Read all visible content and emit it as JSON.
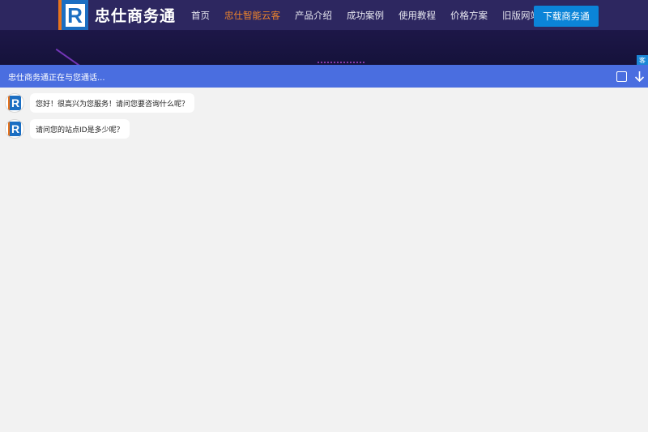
{
  "header": {
    "logo_text": "忠仕商务通",
    "logo_letter": "R",
    "nav": [
      {
        "label": "首页",
        "active": false
      },
      {
        "label": "忠仕智能云客",
        "active": true
      },
      {
        "label": "产品介绍",
        "active": false
      },
      {
        "label": "成功案例",
        "active": false
      },
      {
        "label": "使用教程",
        "active": false
      },
      {
        "label": "价格方案",
        "active": false
      },
      {
        "label": "旧版网站",
        "active": false
      }
    ],
    "download_label": "下载商务通",
    "side_tab_label": "客"
  },
  "chat": {
    "status_text": "忠仕商务通正在与您通话...",
    "avatar_letter": "R",
    "messages": [
      {
        "text": "您好！很高兴为您服务！请问您要咨询什么呢？"
      },
      {
        "text": "请问您的站点ID是多少呢？"
      }
    ]
  },
  "colors": {
    "header_bg": "#1d1748",
    "nav_active": "#f0862b",
    "download_button": "#0b84d8",
    "chat_titlebar": "#4a6ee0",
    "chat_background": "#f2f2f2"
  }
}
